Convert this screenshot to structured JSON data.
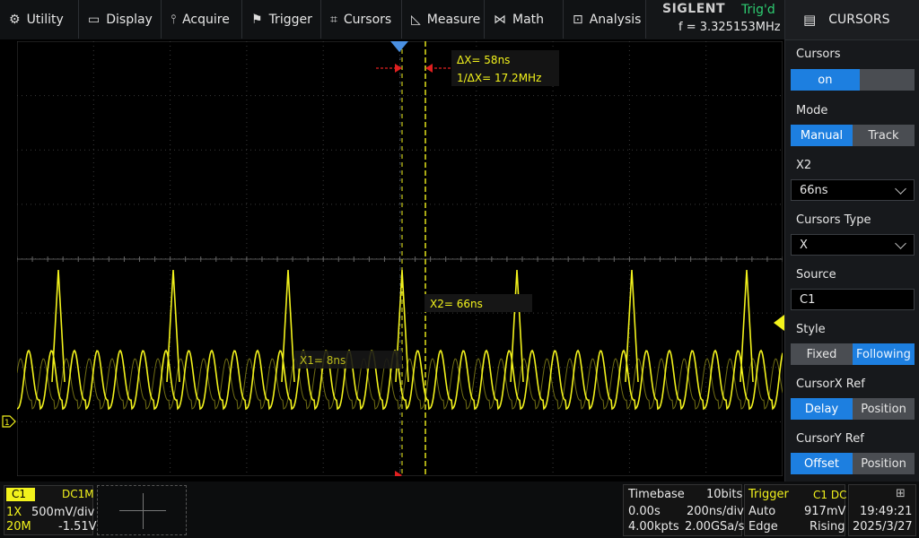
{
  "menu": [
    {
      "label": "Utility",
      "icon": "gear-icon",
      "glyph": "⚙"
    },
    {
      "label": "Display",
      "icon": "monitor-icon",
      "glyph": "▭"
    },
    {
      "label": "Acquire",
      "icon": "acquire-icon",
      "glyph": "⫯"
    },
    {
      "label": "Trigger",
      "icon": "flag-icon",
      "glyph": "⚑"
    },
    {
      "label": "Cursors",
      "icon": "crosshair-icon",
      "glyph": "⌗"
    },
    {
      "label": "Measure",
      "icon": "ruler-icon",
      "glyph": "◺"
    },
    {
      "label": "Math",
      "icon": "math-icon",
      "glyph": "⋈"
    },
    {
      "label": "Analysis",
      "icon": "analysis-icon",
      "glyph": "⊡"
    }
  ],
  "brand": {
    "logo": "SIGLENT",
    "trig_status": "Trig'd",
    "frequency": "f = 3.325153MHz"
  },
  "panel": {
    "title": "CURSORS",
    "cursors": {
      "label": "Cursors",
      "value": "on"
    },
    "mode": {
      "label": "Mode",
      "options": [
        "Manual",
        "Track"
      ],
      "selected": "Manual"
    },
    "x2": {
      "label": "X2",
      "value": "66ns"
    },
    "cursors_type": {
      "label": "Cursors Type",
      "value": "X"
    },
    "source": {
      "label": "Source",
      "value": "C1"
    },
    "style": {
      "label": "Style",
      "options": [
        "Fixed",
        "Following"
      ],
      "selected": "Following"
    },
    "cursorx_ref": {
      "label": "CursorX Ref",
      "options": [
        "Delay",
        "Position"
      ],
      "selected": "Delay"
    },
    "cursory_ref": {
      "label": "CursorY Ref",
      "options": [
        "Offset",
        "Position"
      ],
      "selected": "Offset"
    }
  },
  "readouts": {
    "delta_x": "ΔX= 58ns",
    "inv_delta_x": "1/ΔX= 17.2MHz",
    "x1": "X1= 8ns",
    "x2": "X2= 66ns"
  },
  "channel": {
    "name": "C1",
    "coupling": "DC1M",
    "probe": "1X",
    "scale": "500mV/div",
    "bw": "20M",
    "offset": "-1.51V"
  },
  "timebase": {
    "label": "Timebase",
    "bits": "10bits",
    "delay": "0.00s",
    "scale": "200ns/div",
    "points": "4.00kpts",
    "rate": "2.00GSa/s"
  },
  "trigger": {
    "label": "Trigger",
    "source": "C1 DC",
    "mode": "Auto",
    "level": "917mV",
    "type": "Edge",
    "slope": "Rising"
  },
  "clock": {
    "time": "19:49:21",
    "date": "2025/3/27"
  },
  "colors": {
    "trace": "#f2f21c",
    "accent": "#1d7fe0",
    "trig_ok": "#2ecc71",
    "cursor_arrow": "#e02020"
  }
}
